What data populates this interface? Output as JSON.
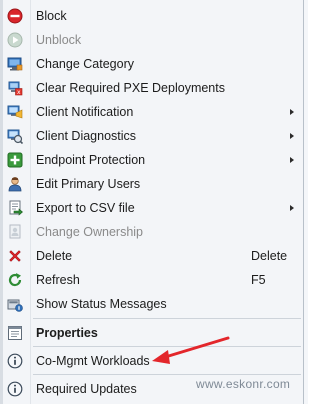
{
  "menu": {
    "items": [
      {
        "label": "Block",
        "icon": "block-icon"
      },
      {
        "label": "Unblock",
        "icon": "unblock-icon",
        "disabled": true
      },
      {
        "label": "Change Category",
        "icon": "change-category-icon"
      },
      {
        "label": "Clear Required PXE Deployments",
        "icon": "pxe-icon"
      },
      {
        "label": "Client Notification",
        "icon": "client-notification-icon",
        "submenu": true
      },
      {
        "label": "Client Diagnostics",
        "icon": "client-diagnostics-icon",
        "submenu": true
      },
      {
        "label": "Endpoint Protection",
        "icon": "endpoint-protection-icon",
        "submenu": true
      },
      {
        "label": "Edit Primary Users",
        "icon": "edit-users-icon"
      },
      {
        "label": "Export to CSV file",
        "icon": "export-csv-icon",
        "submenu": true
      },
      {
        "label": "Change Ownership",
        "icon": "change-ownership-icon",
        "disabled": true
      },
      {
        "label": "Delete",
        "icon": "delete-icon",
        "shortcut": "Delete"
      },
      {
        "label": "Refresh",
        "icon": "refresh-icon",
        "shortcut": "F5"
      },
      {
        "label": "Show Status Messages",
        "icon": "status-messages-icon"
      },
      {
        "label": "Properties",
        "icon": "properties-icon",
        "bold": true
      },
      {
        "label": "Co-Mgmt Workloads",
        "icon": "info-icon"
      },
      {
        "label": "Required Updates",
        "icon": "info-icon"
      }
    ]
  },
  "watermark": "www.eskonr.com",
  "colors": {
    "menu_background": "#f3f5f8",
    "separator": "#cdd3da",
    "callout_arrow": "#e3262b"
  }
}
